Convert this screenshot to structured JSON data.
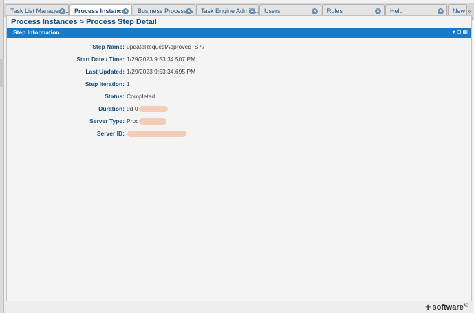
{
  "tabs": [
    {
      "label": "Task List Managem...",
      "active": false
    },
    {
      "label": "Process Instances",
      "active": true
    },
    {
      "label": "Business Processes",
      "active": false
    },
    {
      "label": "Task Engine Admini...",
      "active": false
    },
    {
      "label": "Users",
      "active": false
    },
    {
      "label": "Roles",
      "active": false
    },
    {
      "label": "Help",
      "active": false
    },
    {
      "label": "New",
      "active": false
    }
  ],
  "breadcrumb": "Process Instances > Process Step Detail",
  "section": {
    "title": "Step Information"
  },
  "fields": {
    "step_name": {
      "label": "Step Name:",
      "value": "updateRequestApproved_S77"
    },
    "start_date": {
      "label": "Start Date / Time:",
      "value": "1/29/2023 9:53:34.507 PM"
    },
    "last_updated": {
      "label": "Last Updated:",
      "value": "1/29/2023 9:53:34.695 PM"
    },
    "step_iteration": {
      "label": "Step Iteration:",
      "value": "1"
    },
    "status": {
      "label": "Status:",
      "value": "Completed"
    },
    "duration": {
      "label": "Duration:",
      "value": "0d 0"
    },
    "server_type": {
      "label": "Server Type:",
      "value": "Proc"
    },
    "server_id": {
      "label": "Server ID:",
      "value": ""
    }
  },
  "footer": {
    "logo": "software",
    "logo_suffix": "AG"
  },
  "colors": {
    "header_blue": "#1b7ac4",
    "label_blue": "#1f4f78",
    "redaction": "#f3cdb8"
  }
}
